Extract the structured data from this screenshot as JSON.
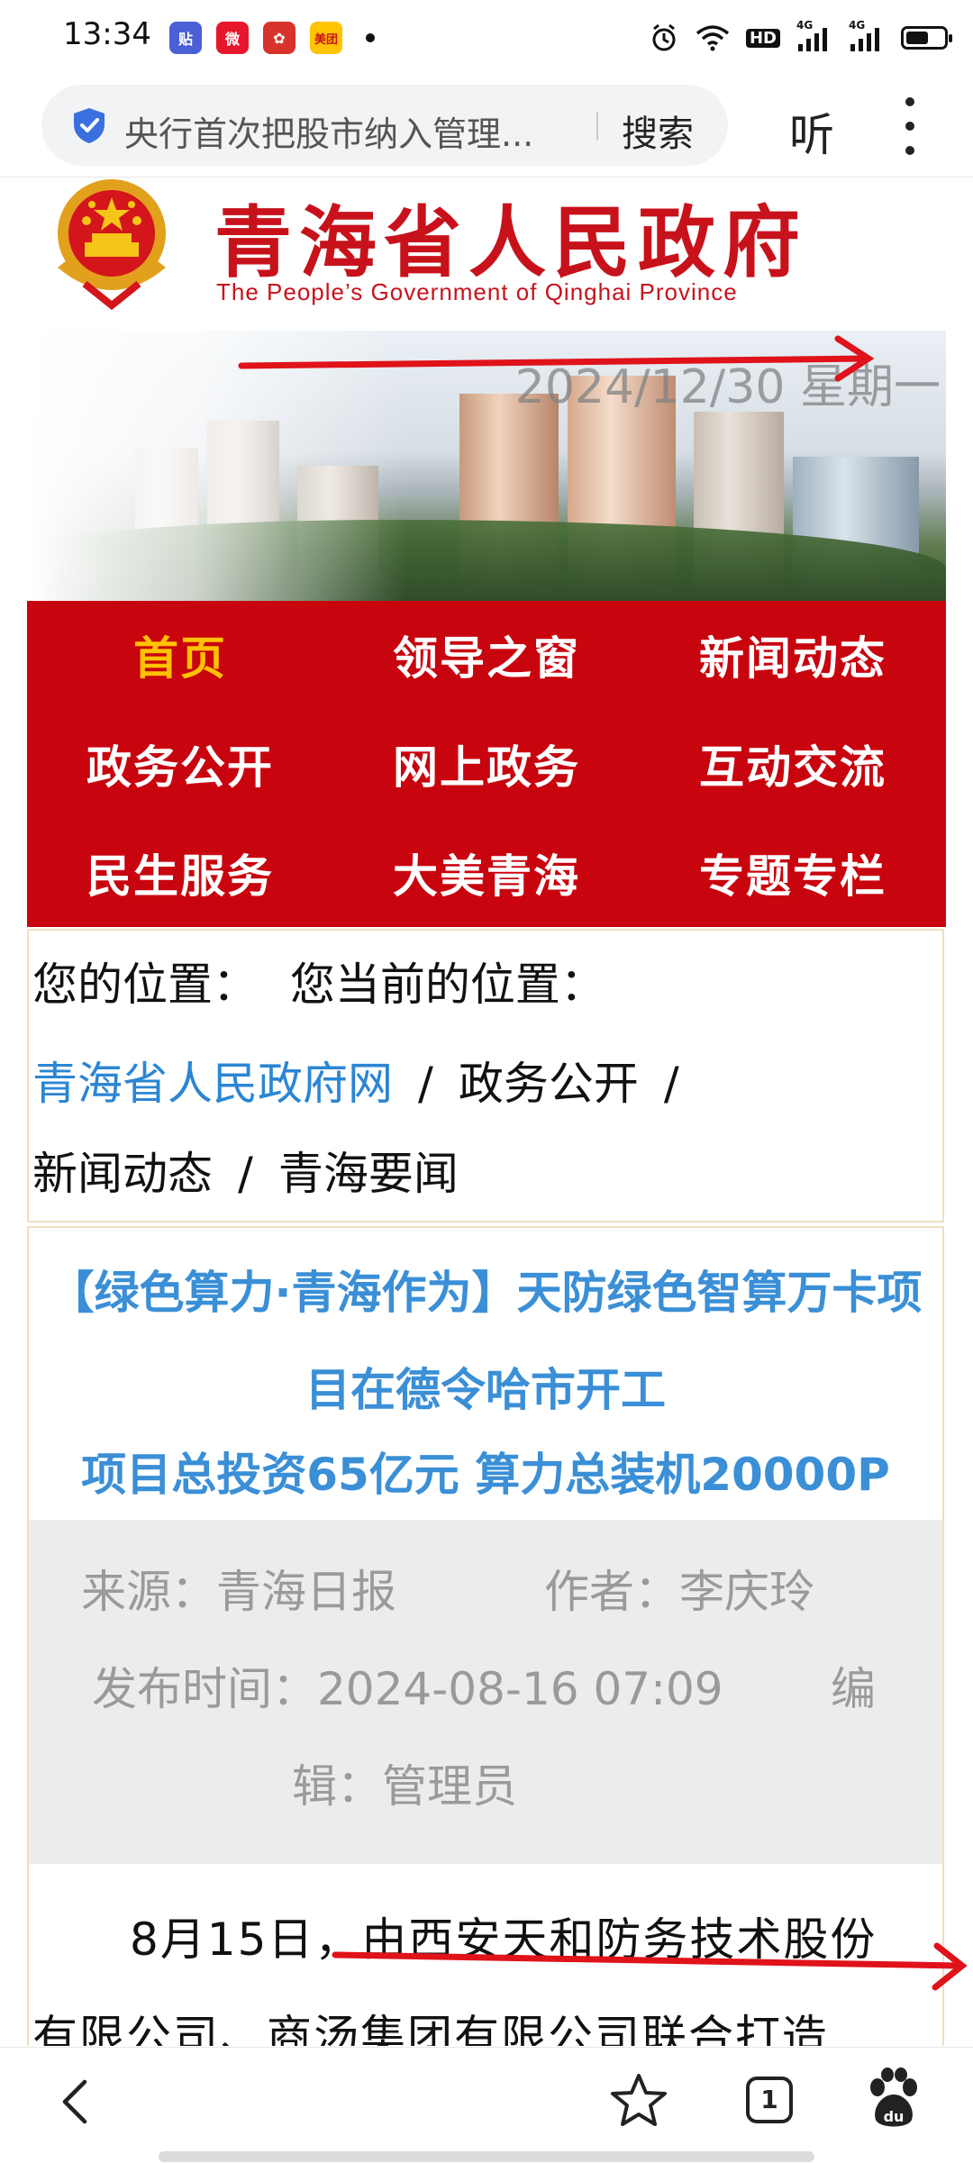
{
  "status_bar": {
    "time": "13:34",
    "apps": [
      {
        "name": "tieba-app-icon",
        "label": "贴",
        "color": "#4b5fd6"
      },
      {
        "name": "weibo-app-icon",
        "label": "微",
        "color": "#e6162d"
      },
      {
        "name": "app-icon-3",
        "label": "✿",
        "color": "#d6342a"
      },
      {
        "name": "meituan-app-icon",
        "label": "美团",
        "color": "#ffc300"
      }
    ],
    "icons": [
      "alarm-icon",
      "wifi-icon",
      "hd-icon",
      "signal-4g-icon",
      "signal-4g-icon",
      "battery-icon"
    ],
    "hd_label": "HD",
    "net_label_1": "4G",
    "net_label_2": "4G",
    "battery_level": 0.6
  },
  "browser": {
    "address_text": "央行首次把股市纳入管理...",
    "search_label": "搜索",
    "listen_label": "听"
  },
  "header": {
    "title": "青海省人民政府",
    "subtitle": "The People’s Government of Qinghai Province",
    "date": "2024/12/30 星期一"
  },
  "nav": {
    "items": [
      {
        "label": "首页",
        "active": true
      },
      {
        "label": "领导之窗",
        "active": false
      },
      {
        "label": "新闻动态",
        "active": false
      },
      {
        "label": "政务公开",
        "active": false
      },
      {
        "label": "网上政务",
        "active": false
      },
      {
        "label": "互动交流",
        "active": false
      },
      {
        "label": "民生服务",
        "active": false
      },
      {
        "label": "大美青海",
        "active": false
      },
      {
        "label": "专题专栏",
        "active": false
      }
    ]
  },
  "breadcrumb": {
    "label": "您的位置：",
    "current_label": "您当前的位置：",
    "link_home": "青海省人民政府网",
    "sep": "/",
    "item_1": "政务公开",
    "item_2": "新闻动态",
    "item_3": "青海要闻"
  },
  "article": {
    "title": "【绿色算力·青海作为】天防绿色智算万卡项目在德令哈市开工",
    "subtitle": "项目总投资65亿元 算力总装机20000P",
    "source_label": "来源：",
    "source": "青海日报",
    "author_label": "作者：",
    "author": "李庆玲",
    "date_label": "发布时间：",
    "date": "2024-08-16 07:09",
    "editor_label_a": "编",
    "editor_label_b": "辑：",
    "editor": "管理员",
    "body_line_1": "8月15日，由西安天和防务技术股份",
    "body_line_2": "有限公司、商汤集团有限公司联合打造"
  },
  "bottom_nav": {
    "tab_count": "1"
  },
  "colors": {
    "brand_red": "#c8040e",
    "active_nav": "#ffc200",
    "link_blue": "#2b86d3",
    "title_blue": "#3a8fd6",
    "annotation_red": "#e0121a"
  }
}
